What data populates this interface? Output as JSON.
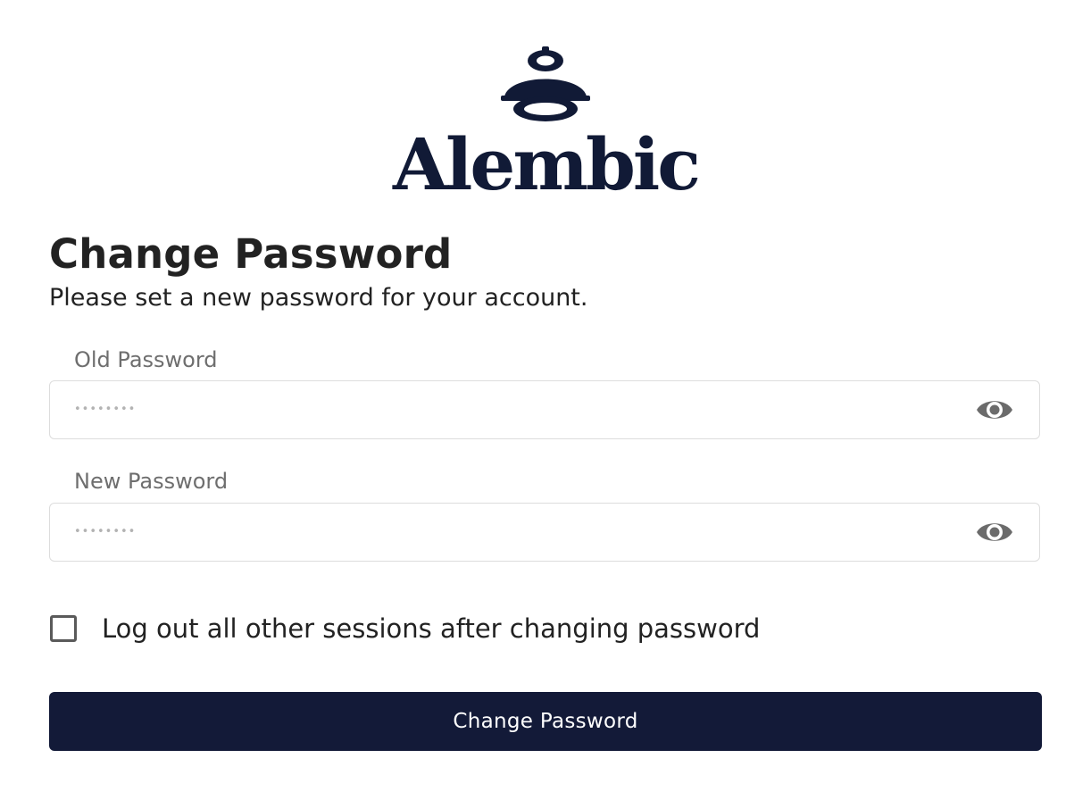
{
  "brand": {
    "name": "Alembic",
    "logo_icon": "alembic-logo-icon",
    "color": "#111a36"
  },
  "heading": {
    "title": "Change Password",
    "subtitle": "Please set a new password for your account."
  },
  "form": {
    "old_password": {
      "label": "Old Password",
      "value": "••••••••",
      "toggle_icon": "eye-icon"
    },
    "new_password": {
      "label": "New Password",
      "value": "••••••••",
      "toggle_icon": "eye-icon"
    },
    "logout_option": {
      "label": "Log out all other sessions after changing password",
      "checked": false
    },
    "submit_label": "Change Password"
  },
  "colors": {
    "primary": "#131a38",
    "border": "#dddddd",
    "label": "#6e6e6e",
    "icon": "#6b6b6b"
  }
}
